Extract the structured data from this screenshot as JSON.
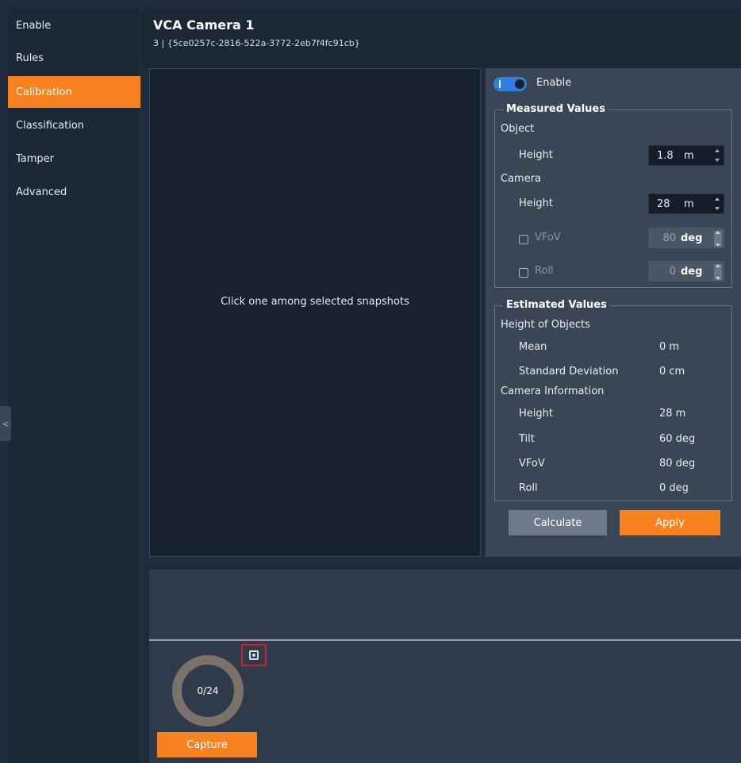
{
  "sidebar": {
    "items": [
      {
        "label": "Enable"
      },
      {
        "label": "Rules"
      },
      {
        "label": "Calibration",
        "active": true
      },
      {
        "label": "Classification"
      },
      {
        "label": "Tamper"
      },
      {
        "label": "Advanced"
      }
    ],
    "collapse_icon": "chevron-left-icon",
    "collapse_glyph": "<"
  },
  "header": {
    "title": "VCA Camera 1",
    "subtitle": "3 | {5ce0257c-2816-522a-3772-2eb7f4fc91cb}"
  },
  "snapshot": {
    "message": "Click one among selected snapshots"
  },
  "calibration": {
    "enable_label": "Enable",
    "enable_on": true,
    "measured": {
      "legend": "Measured Values",
      "object_label": "Object",
      "object_height_label": "Height",
      "object_height_value": "1.8",
      "object_height_unit": "m",
      "camera_label": "Camera",
      "camera_height_label": "Height",
      "camera_height_value": "28",
      "camera_height_unit": "m",
      "vfov_label": "VFoV",
      "vfov_value": "80",
      "vfov_unit": "deg",
      "vfov_checked": false,
      "roll_label": "Roll",
      "roll_value": "0",
      "roll_unit": "deg",
      "roll_checked": false
    },
    "estimated": {
      "legend": "Estimated Values",
      "objects_label": "Height of Objects",
      "mean_label": "Mean",
      "mean_value": "0 m",
      "std_label": "Standard Deviation",
      "std_value": "0 cm",
      "camera_info_label": "Camera Information",
      "height_label": "Height",
      "height_value": "28 m",
      "tilt_label": "Tilt",
      "tilt_value": "60 deg",
      "vfov_label": "VFoV",
      "vfov_value": "80 deg",
      "roll_label": "Roll",
      "roll_value": "0 deg"
    },
    "calculate_label": "Calculate",
    "apply_label": "Apply"
  },
  "capture": {
    "counter": "0/24",
    "button_label": "Capture",
    "settings_icon": "capture-settings-icon"
  },
  "colors": {
    "accent": "#f7821f",
    "toggle": "#2f7fe0",
    "highlight_border": "#d0202a"
  }
}
